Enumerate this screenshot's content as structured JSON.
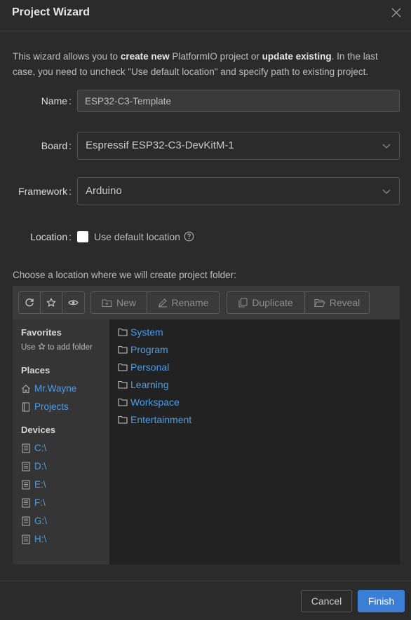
{
  "dialog": {
    "title": "Project Wizard",
    "intro": {
      "p1": "This wizard allows you to ",
      "b1": "create new",
      "p2": " PlatformIO project or ",
      "b2": "update existing",
      "p3": ". In the last case, you need to uncheck \"Use default location\" and specify path to existing project."
    }
  },
  "form": {
    "name_label": "Name",
    "name_value": "ESP32-C3-Template",
    "board_label": "Board",
    "board_value": "Espressif ESP32-C3-DevKitM-1",
    "framework_label": "Framework",
    "framework_value": "Arduino",
    "location_label": "Location",
    "use_default_location_label": "Use default location",
    "use_default_location_checked": false,
    "colon": ":"
  },
  "browser": {
    "choose_text": "Choose a location where we will create project folder:",
    "toolbar": {
      "new_label": "New",
      "rename_label": "Rename",
      "duplicate_label": "Duplicate",
      "reveal_label": "Reveal"
    },
    "sidebar": {
      "favorites_heading": "Favorites",
      "favorites_hint_pre": "Use",
      "favorites_hint_post": "to add folder",
      "places_heading": "Places",
      "places": [
        "Mr.Wayne",
        "Projects"
      ],
      "devices_heading": "Devices",
      "devices": [
        "C:\\",
        "D:\\",
        "E:\\",
        "F:\\",
        "G:\\",
        "H:\\"
      ]
    },
    "folders": [
      "System",
      "Program",
      "Personal",
      "Learning",
      "Workspace",
      "Entertainment"
    ]
  },
  "footer": {
    "cancel_label": "Cancel",
    "finish_label": "Finish"
  },
  "colors": {
    "background": "#2b2b2b",
    "link": "#4a9eea",
    "accent": "#3a7fd5"
  }
}
